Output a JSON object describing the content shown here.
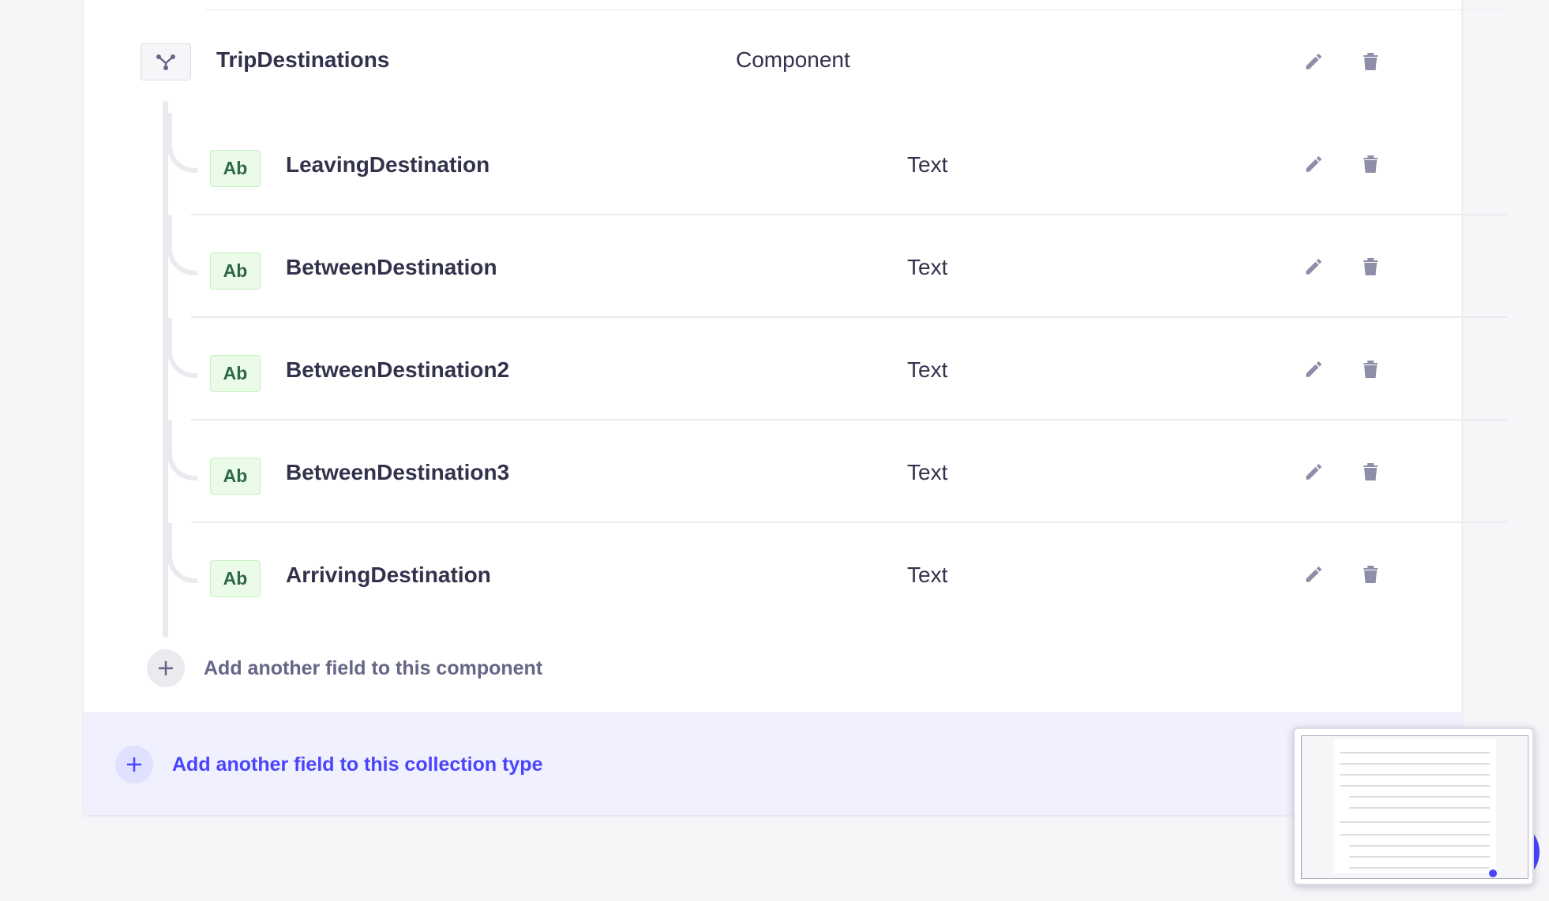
{
  "component": {
    "name": "TripDestinations",
    "type": "Component",
    "icon": "component-icon"
  },
  "fields": [
    {
      "badge": "Ab",
      "name": "LeavingDestination",
      "type": "Text"
    },
    {
      "badge": "Ab",
      "name": "BetweenDestination",
      "type": "Text"
    },
    {
      "badge": "Ab",
      "name": "BetweenDestination2",
      "type": "Text"
    },
    {
      "badge": "Ab",
      "name": "BetweenDestination3",
      "type": "Text"
    },
    {
      "badge": "Ab",
      "name": "ArrivingDestination",
      "type": "Text"
    }
  ],
  "add_component_field_label": "Add another field to this component",
  "add_collection_field_label": "Add another field to this collection type",
  "icons": {
    "edit": "pencil-icon",
    "delete": "trash-icon",
    "add": "plus-icon"
  },
  "colors": {
    "accent": "#4945ff",
    "text_badge_bg": "#eafbe7",
    "text_badge_fg": "#2f6846",
    "action_icon": "#8e8ea9"
  }
}
